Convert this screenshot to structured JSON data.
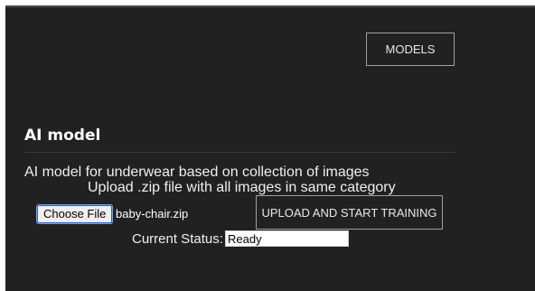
{
  "header": {
    "models_label": "MODELS"
  },
  "main": {
    "title": "AI model",
    "description": "AI model for underwear based on collection of images",
    "instruction": "Upload .zip file with all images in same category",
    "file_input": {
      "button_label": "Choose File",
      "file_name": "baby-chair.zip"
    },
    "upload_label": "UPLOAD AND START TRAINING",
    "status": {
      "label": "Current Status:",
      "value": "Ready"
    }
  }
}
